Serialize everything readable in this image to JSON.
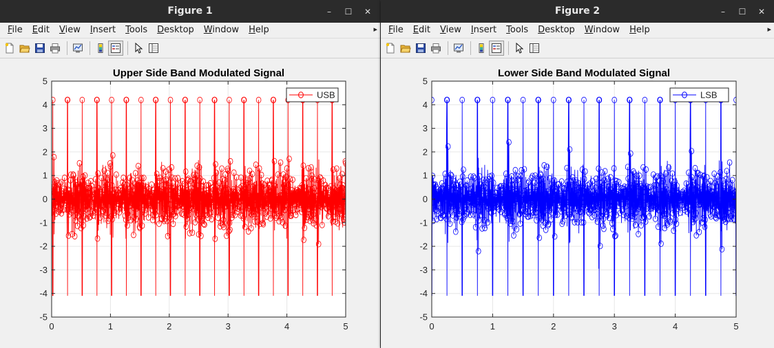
{
  "windows": [
    {
      "title": "Figure 1",
      "menu": [
        "File",
        "Edit",
        "View",
        "Insert",
        "Tools",
        "Desktop",
        "Window",
        "Help"
      ],
      "plot": {
        "title": "Upper Side Band Modulated Signal",
        "legend": "USB",
        "color": "#ff0000"
      }
    },
    {
      "title": "Figure 2",
      "menu": [
        "File",
        "Edit",
        "View",
        "Insert",
        "Tools",
        "Desktop",
        "Window",
        "Help"
      ],
      "plot": {
        "title": "Lower Side Band Modulated Signal",
        "legend": "LSB",
        "color": "#0000ff"
      }
    }
  ],
  "window_buttons": {
    "minimize": "–",
    "maximize": "☐",
    "close": "✕"
  },
  "menu_overflow": "▸",
  "toolbar_icons": [
    "new-figure-icon",
    "open-file-icon",
    "save-icon",
    "print-icon",
    "link-plot-icon",
    "colorbar-icon",
    "legend-icon",
    "pointer-icon",
    "property-editor-icon"
  ],
  "chart_data": [
    {
      "type": "line",
      "title": "Upper Side Band Modulated Signal",
      "xlabel": "",
      "ylabel": "",
      "xlim": [
        0,
        5
      ],
      "ylim": [
        -5,
        5
      ],
      "xticks": [
        0,
        1,
        2,
        3,
        4,
        5
      ],
      "yticks": [
        -5,
        -4,
        -3,
        -2,
        -1,
        0,
        1,
        2,
        3,
        4,
        5
      ],
      "grid": true,
      "legend_position": "top-right",
      "marker": "circle",
      "series": [
        {
          "name": "USB",
          "color": "#ff0000",
          "amplitude_peak": 4.2,
          "amplitude_min": -4.1,
          "peak_period": 0.25,
          "first_peak_x": 0.27
        }
      ]
    },
    {
      "type": "line",
      "title": "Lower Side Band Modulated Signal",
      "xlabel": "",
      "ylabel": "",
      "xlim": [
        0,
        5
      ],
      "ylim": [
        -5,
        5
      ],
      "xticks": [
        0,
        1,
        2,
        3,
        4,
        5
      ],
      "yticks": [
        -5,
        -4,
        -3,
        -2,
        -1,
        0,
        1,
        2,
        3,
        4,
        5
      ],
      "grid": true,
      "legend_position": "top-right",
      "marker": "circle",
      "series": [
        {
          "name": "LSB",
          "color": "#0000ff",
          "amplitude_peak": 4.2,
          "amplitude_min": -4.1,
          "peak_period": 0.25,
          "first_peak_x": 0.0
        }
      ]
    }
  ]
}
